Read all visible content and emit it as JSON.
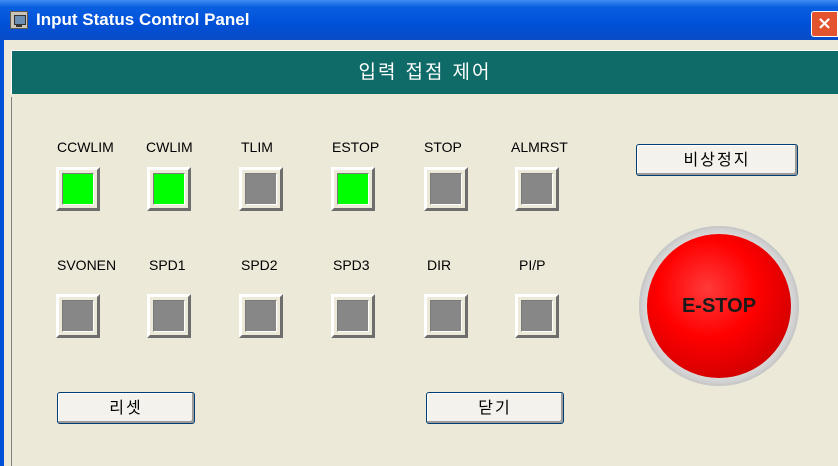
{
  "window": {
    "title": "Input Status Control Panel",
    "close_glyph": "×"
  },
  "header": {
    "title": "입력 접점 제어"
  },
  "inputs_row1": [
    {
      "label": "CCWLIM",
      "state": "on"
    },
    {
      "label": "CWLIM",
      "state": "on"
    },
    {
      "label": "TLIM",
      "state": "off"
    },
    {
      "label": "ESTOP",
      "state": "on"
    },
    {
      "label": "STOP",
      "state": "off"
    },
    {
      "label": "ALMRST",
      "state": "off"
    }
  ],
  "inputs_row2": [
    {
      "label": "SVONEN",
      "state": "off"
    },
    {
      "label": "SPD1",
      "state": "off"
    },
    {
      "label": "SPD2",
      "state": "off"
    },
    {
      "label": "SPD3",
      "state": "off"
    },
    {
      "label": "DIR",
      "state": "off"
    },
    {
      "label": "PI/P",
      "state": "off"
    }
  ],
  "buttons": {
    "emergency_stop": "비상정지",
    "reset": "리셋",
    "close": "닫기",
    "estop_big": "E-STOP"
  },
  "colors": {
    "led_on": "#00ff00",
    "led_off": "#878787",
    "header_bg": "#0f6b67",
    "estop_red": "#ff0000"
  }
}
